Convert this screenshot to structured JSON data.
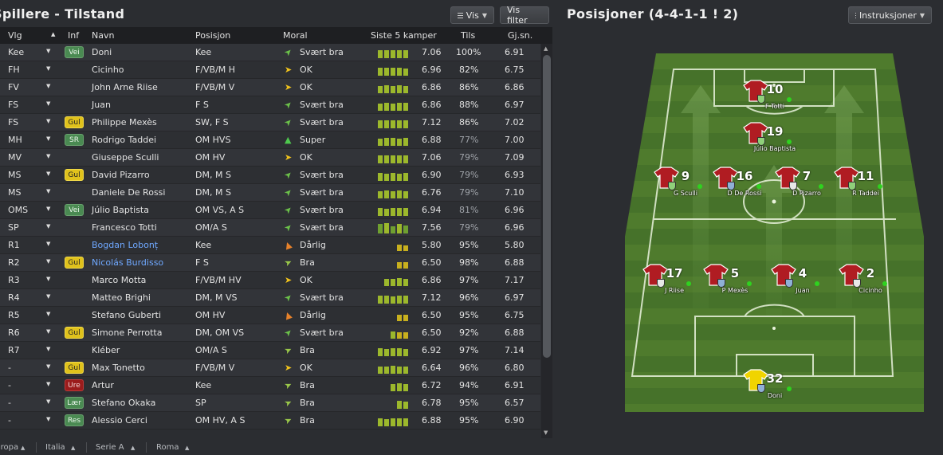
{
  "left": {
    "title": "Spillere - Tilstand",
    "vis_label": "Vis",
    "filter_label": "Vis filter",
    "headers": {
      "vlg": "Vlg",
      "inf": "Inf",
      "navn": "Navn",
      "posisjon": "Posisjon",
      "moral": "Moral",
      "siste": "Siste 5 kamper",
      "tils": "Tils",
      "gjsn": "Gj.sn."
    },
    "rows": [
      {
        "vlg": "Kee",
        "inf": "Vei",
        "navn": "Doni",
        "pos": "Kee",
        "moral": "Svært bra",
        "siste": "7.06",
        "tils": "100%",
        "gj": "6.91"
      },
      {
        "vlg": "FH",
        "inf": "",
        "navn": "Cicinho",
        "pos": "F/VB/M H",
        "moral": "OK",
        "siste": "6.96",
        "tils": "82%",
        "gj": "6.75"
      },
      {
        "vlg": "FV",
        "inf": "",
        "navn": "John Arne Riise",
        "pos": "F/VB/M V",
        "moral": "OK",
        "siste": "6.86",
        "tils": "86%",
        "gj": "6.86"
      },
      {
        "vlg": "FS",
        "inf": "",
        "navn": "Juan",
        "pos": "F S",
        "moral": "Svært bra",
        "siste": "6.86",
        "tils": "88%",
        "gj": "6.97"
      },
      {
        "vlg": "FS",
        "inf": "Gul",
        "navn": "Philippe Mexès",
        "pos": "SW, F S",
        "moral": "Svært bra",
        "siste": "7.12",
        "tils": "86%",
        "gj": "7.02"
      },
      {
        "vlg": "MH",
        "inf": "SR",
        "navn": "Rodrigo Taddei",
        "pos": "OM HVS",
        "moral": "Super",
        "siste": "6.88",
        "tils": "77%",
        "gj": "7.00"
      },
      {
        "vlg": "MV",
        "inf": "",
        "navn": "Giuseppe Sculli",
        "pos": "OM HV",
        "moral": "OK",
        "siste": "7.06",
        "tils": "79%",
        "gj": "7.09"
      },
      {
        "vlg": "MS",
        "inf": "Gul",
        "navn": "David Pizarro",
        "pos": "DM, M S",
        "moral": "Svært bra",
        "siste": "6.90",
        "tils": "79%",
        "gj": "6.93"
      },
      {
        "vlg": "MS",
        "inf": "",
        "navn": "Daniele De Rossi",
        "pos": "DM, M S",
        "moral": "Svært bra",
        "siste": "6.76",
        "tils": "79%",
        "gj": "7.10"
      },
      {
        "vlg": "OMS",
        "inf": "Vei",
        "navn": "Júlio Baptista",
        "pos": "OM VS, A S",
        "moral": "Svært bra",
        "siste": "6.94",
        "tils": "81%",
        "gj": "6.96"
      },
      {
        "vlg": "SP",
        "inf": "",
        "navn": "Francesco Totti",
        "pos": "OM/A S",
        "moral": "Svært bra",
        "siste": "7.56",
        "tils": "79%",
        "gj": "6.96"
      },
      {
        "vlg": "R1",
        "inf": "",
        "navn": "Bogdan Lobonț",
        "pos": "Kee",
        "moral": "Dårlig",
        "siste": "5.80",
        "tils": "95%",
        "gj": "5.80"
      },
      {
        "vlg": "R2",
        "inf": "Gul",
        "navn": "Nicolás Burdisso",
        "pos": "F S",
        "moral": "Bra",
        "siste": "6.50",
        "tils": "98%",
        "gj": "6.88"
      },
      {
        "vlg": "R3",
        "inf": "",
        "navn": "Marco Motta",
        "pos": "F/VB/M HV",
        "moral": "OK",
        "siste": "6.86",
        "tils": "97%",
        "gj": "7.17"
      },
      {
        "vlg": "R4",
        "inf": "",
        "navn": "Matteo Brighi",
        "pos": "DM, M VS",
        "moral": "Svært bra",
        "siste": "7.12",
        "tils": "96%",
        "gj": "6.97"
      },
      {
        "vlg": "R5",
        "inf": "",
        "navn": "Stefano Guberti",
        "pos": "OM HV",
        "moral": "Dårlig",
        "siste": "6.50",
        "tils": "95%",
        "gj": "6.75"
      },
      {
        "vlg": "R6",
        "inf": "Gul",
        "navn": "Simone Perrotta",
        "pos": "DM, OM VS",
        "moral": "Svært bra",
        "siste": "6.50",
        "tils": "92%",
        "gj": "6.88"
      },
      {
        "vlg": "R7",
        "inf": "",
        "navn": "Kléber",
        "pos": "OM/A S",
        "moral": "Bra",
        "siste": "6.92",
        "tils": "97%",
        "gj": "7.14"
      },
      {
        "vlg": "-",
        "inf": "Gul",
        "navn": "Max Tonetto",
        "pos": "F/VB/M V",
        "moral": "OK",
        "siste": "6.64",
        "tils": "96%",
        "gj": "6.80"
      },
      {
        "vlg": "-",
        "inf": "Ure",
        "navn": "Artur",
        "pos": "Kee",
        "moral": "Bra",
        "siste": "6.72",
        "tils": "94%",
        "gj": "6.91"
      },
      {
        "vlg": "-",
        "inf": "Lær",
        "navn": "Stefano Okaka",
        "pos": "SP",
        "moral": "Bra",
        "siste": "6.78",
        "tils": "95%",
        "gj": "6.57"
      },
      {
        "vlg": "-",
        "inf": "Res",
        "navn": "Alessio Cerci",
        "pos": "OM HV, A S",
        "moral": "Bra",
        "siste": "6.88",
        "tils": "95%",
        "gj": "6.90"
      }
    ],
    "footer": [
      "Europa",
      "Italia",
      "Serie A",
      "Roma"
    ]
  },
  "right": {
    "title": "Posisjoner (4-4-1-1 ! 2)",
    "instr_label": "Instruksjoner",
    "players": [
      {
        "num": "10",
        "name": "F Totti",
        "shield": "green"
      },
      {
        "num": "19",
        "name": "Júlio Baptista",
        "shield": "green"
      },
      {
        "num": "9",
        "name": "G Sculli",
        "shield": "green"
      },
      {
        "num": "16",
        "name": "D De Rossi",
        "shield": "blue"
      },
      {
        "num": "7",
        "name": "D Pizarro",
        "shield": "white"
      },
      {
        "num": "11",
        "name": "R Taddei",
        "shield": "green"
      },
      {
        "num": "17",
        "name": "J Riise",
        "shield": "white"
      },
      {
        "num": "5",
        "name": "P Mexès",
        "shield": "blue"
      },
      {
        "num": "4",
        "name": "Juan",
        "shield": "blue"
      },
      {
        "num": "2",
        "name": "Cicinho",
        "shield": "white"
      },
      {
        "num": "32",
        "name": "Doni",
        "shield": "blue",
        "gk": true
      }
    ]
  },
  "colors": {
    "bar_green": "#9cb82c",
    "bar_yellow": "#c8b01e",
    "shirt_red": "#b01c22",
    "gk_yellow": "#f0d400",
    "pitch_green": "#4e7a2c"
  }
}
